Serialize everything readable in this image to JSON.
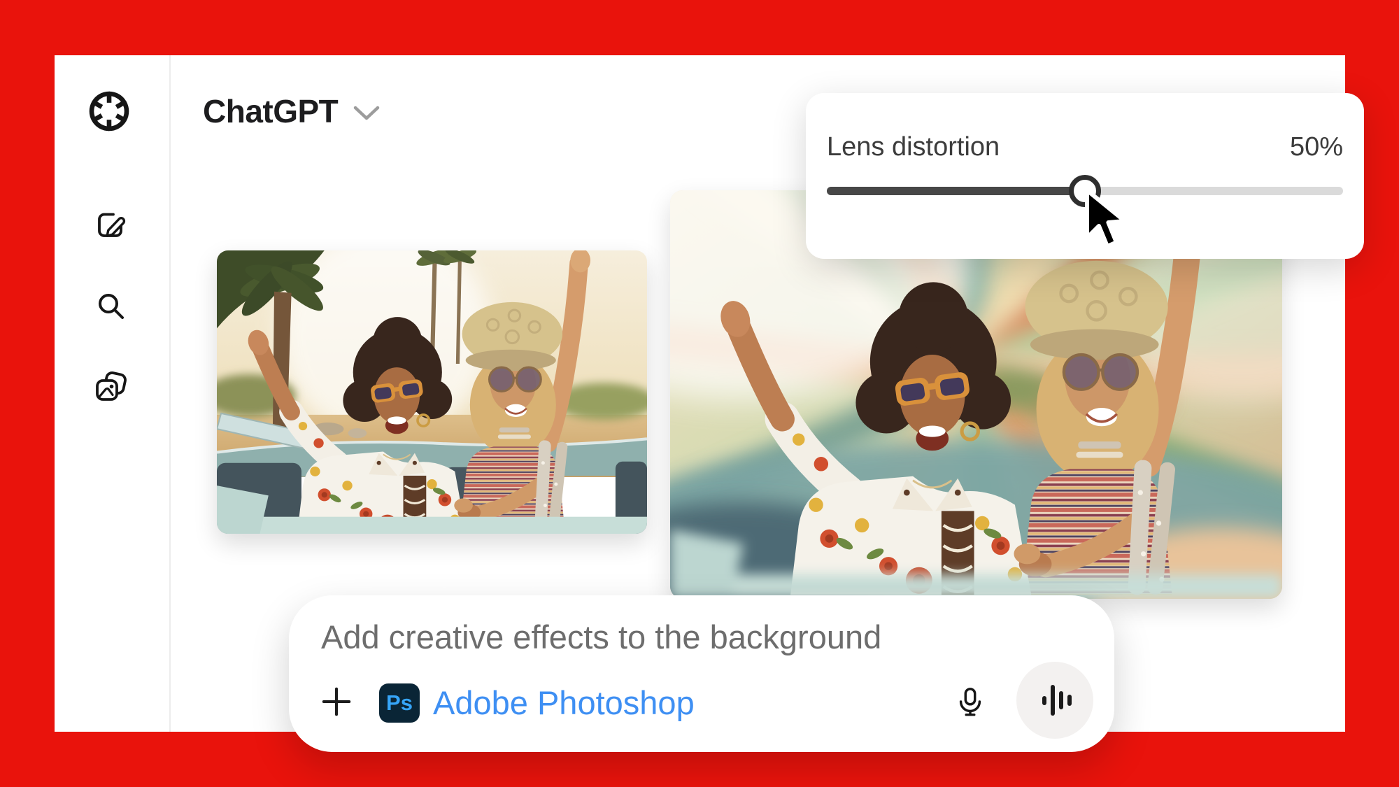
{
  "colors": {
    "frame-red": "#E9130C",
    "link-blue": "#3E8FF3",
    "ps-badge-bg": "#0A2536",
    "ps-badge-text": "#36A5F8",
    "track-dark": "#474747",
    "track-light": "#DADADA",
    "label-gray": "#3C3C3C",
    "prompt-gray": "#6D6D6D",
    "icon-black": "#161616",
    "divider": "#ECECEC"
  },
  "header": {
    "title": "ChatGPT",
    "dropdown_icon": "chevron-down-icon"
  },
  "sidebar": {
    "logo_icon": "openai-logo",
    "items": [
      {
        "icon": "new-chat-icon"
      },
      {
        "icon": "search-icon"
      },
      {
        "icon": "image-library-icon"
      }
    ]
  },
  "distortion_panel": {
    "label": "Lens distortion",
    "value": "50%",
    "percent": 50
  },
  "photos": {
    "left": "original photo of two friends in convertible",
    "right": "photo with lens distortion zoom-blur background"
  },
  "prompt_bar": {
    "text": "Add creative effects to the background",
    "plus_icon": "plus-icon",
    "attachment": {
      "badge": "Ps",
      "name": "Adobe Photoshop"
    },
    "mic_icon": "microphone-icon",
    "voice_icon": "voice-waveform-icon"
  }
}
